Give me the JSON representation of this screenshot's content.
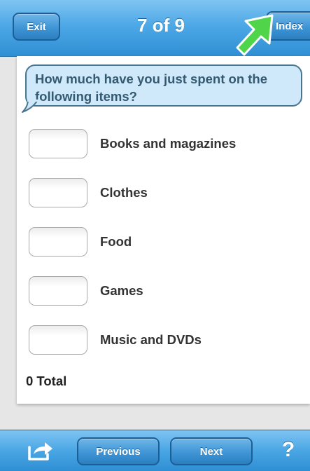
{
  "header": {
    "exit_label": "Exit",
    "page_indicator": "7 of 9",
    "index_label": "Index"
  },
  "question": {
    "text": "How much have you just spent on the following items?"
  },
  "items": [
    {
      "label": "Books and magazines",
      "value": ""
    },
    {
      "label": "Clothes",
      "value": ""
    },
    {
      "label": "Food",
      "value": ""
    },
    {
      "label": "Games",
      "value": ""
    },
    {
      "label": "Music and DVDs",
      "value": ""
    }
  ],
  "total": {
    "text": "0 Total"
  },
  "footer": {
    "share_icon": "share-icon",
    "previous_label": "Previous",
    "next_label": "Next",
    "help_label": "?"
  },
  "colors": {
    "bar_blue": "#3f95d5",
    "bubble_fill": "#cfe9fb",
    "bubble_text": "#345a72",
    "highlight_arrow": "#4fd44a"
  }
}
